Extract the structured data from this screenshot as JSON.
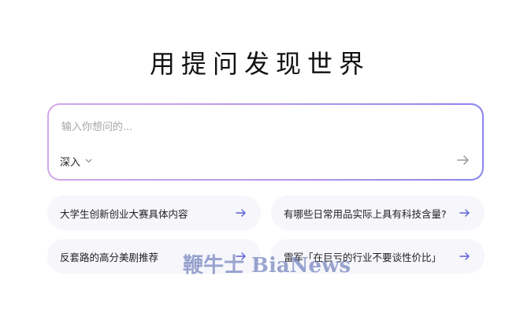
{
  "title": "用提问发现世界",
  "search": {
    "placeholder": "输入你想问的...",
    "value": "",
    "mode_label": "深入"
  },
  "suggestions": [
    "大学生创新创业大赛具体内容",
    "有哪些日常用品实际上具有科技含量?",
    "反套路的高分美剧推荐",
    "雷军「在巨亏的行业不要谈性价比」"
  ],
  "watermark": "鞭牛士 BiaNews",
  "colors": {
    "accent_start": "#d2a8ea",
    "accent_end": "#8a84ee",
    "arrow": "#5b5fd6",
    "chip_bg": "#f6f6fb"
  },
  "icons": {
    "submit": "arrow-right-icon",
    "mode_dropdown": "chevron-down-icon",
    "suggestion": "arrow-right-icon"
  }
}
